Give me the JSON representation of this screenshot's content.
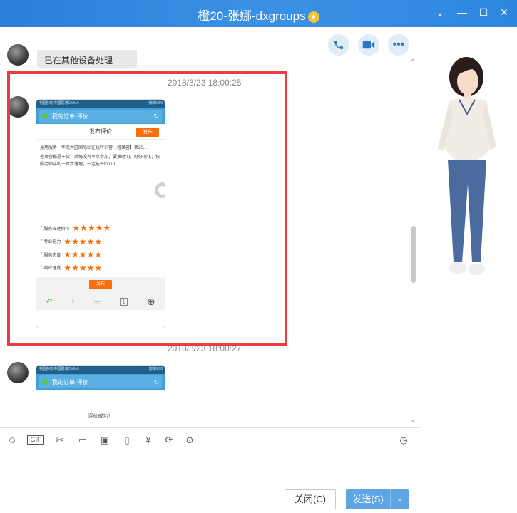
{
  "window": {
    "title": "橙20-张娜-dxgroups",
    "min_glyph": "—",
    "max_glyph": "☐",
    "close_glyph": "✕",
    "chevron_glyph": "⌄"
  },
  "chat": {
    "top_bubble_text": "已在其他设备处理",
    "messages": [
      {
        "timestamp": "2018/3/23 18:00:25"
      },
      {
        "timestamp": "2018/3/23 18:00:27"
      }
    ]
  },
  "phone1": {
    "status_left": "中国移动 中国联通CMMA",
    "status_right": "傍晚5:59",
    "nav_title": "我的订单-评价",
    "header_title": "发布评价",
    "publish_btn": "发布",
    "service_line": "通用服务：华南大区国际站在线特训营【橙果营】第20...",
    "review_text": "橙果营都是干货，后悔没有早点参加，要抽时间，好好消化，按照老师讲的一步步落地，一定能去top10",
    "ratings": [
      {
        "label": "服务描述相符",
        "stars": "★★★★★"
      },
      {
        "label": "专业能力",
        "stars": "★★★★★"
      },
      {
        "label": "服务态度",
        "stars": "★★★★★"
      },
      {
        "label": "响应速度",
        "stars": "★★★★★"
      }
    ],
    "bottom_publish": "发布",
    "nav_icons": [
      "↶",
      "›",
      "☰",
      "1",
      "⊕"
    ]
  },
  "phone2": {
    "status_left": "中国移动 中国联通CMMA",
    "status_right": "傍晚6:00",
    "nav_title": "我的订单-评价",
    "success_text": "评价成功！"
  },
  "toolbar": {
    "gif_label": "GIF"
  },
  "buttons": {
    "close_label": "关闭(C)",
    "send_label": "发送(S)",
    "send_dropdown": "⌄"
  },
  "colors": {
    "titlebar": "#2f86de",
    "highlight_box": "#f13a40",
    "publish_orange": "#f86d0d",
    "send_button": "#5da5e3"
  }
}
